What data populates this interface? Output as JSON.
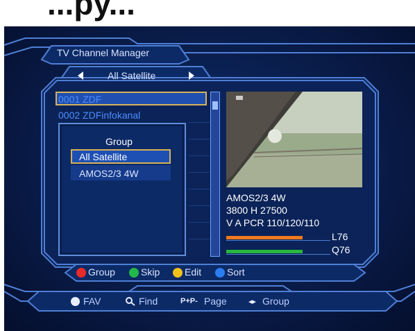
{
  "banner": {
    "text": "...py..."
  },
  "window": {
    "title": "TV Channel Manager"
  },
  "satellite_selector": {
    "label": "All Satellite"
  },
  "channels": [
    {
      "label": "0001 ZDF",
      "selected": true
    },
    {
      "label": "0002 ZDFinfokanal",
      "selected": false
    }
  ],
  "group_popup": {
    "title": "Group",
    "options": [
      {
        "label": "All Satellite",
        "selected": true
      },
      {
        "label": "AMOS2/3 4W",
        "selected": false
      }
    ]
  },
  "info": {
    "satellite": "AMOS2/3 4W",
    "freq": "3800 H 27500",
    "pids": "V A PCR 110/120/110",
    "level_label": "L76",
    "quality_label": "Q76",
    "level": 76,
    "quality": 76,
    "level_color": "#f07a1e",
    "quality_color": "#28b83c"
  },
  "legend": [
    {
      "label": "Group",
      "color": "#e82a2a",
      "icon": "red-dot-icon"
    },
    {
      "label": "Skip",
      "color": "#22b84a",
      "icon": "green-dot-icon"
    },
    {
      "label": "Edit",
      "color": "#f2c21a",
      "icon": "yellow-dot-icon"
    },
    {
      "label": "Sort",
      "color": "#2b7df0",
      "icon": "blue-dot-icon"
    }
  ],
  "footer": {
    "fav": "FAV",
    "find": "Find",
    "page_icon": "P+P-",
    "page": "Page",
    "group_icon": "◂▸",
    "group": "Group"
  }
}
